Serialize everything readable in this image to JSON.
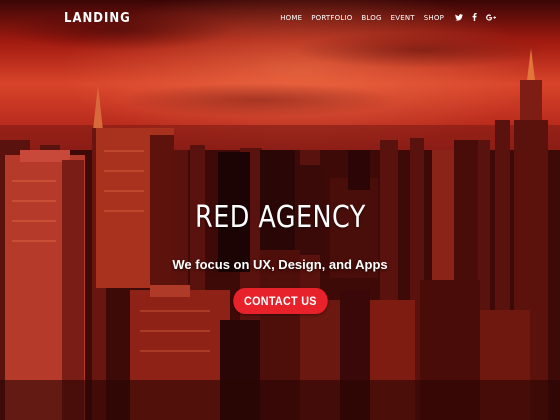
{
  "brand": {
    "logo": "LANDING"
  },
  "nav": {
    "items": [
      "HOME",
      "PORTFOLIO",
      "BLOG",
      "EVENT",
      "SHOP"
    ],
    "social": [
      "twitter-icon",
      "facebook-icon",
      "google-plus-icon"
    ]
  },
  "hero": {
    "title": "RED AGENCY",
    "tagline": "We focus on UX, Design, and Apps",
    "cta_label": "CONTACT US"
  },
  "colors": {
    "accent": "#e8222a",
    "sky": "#d8442a",
    "text": "#ffffff"
  }
}
